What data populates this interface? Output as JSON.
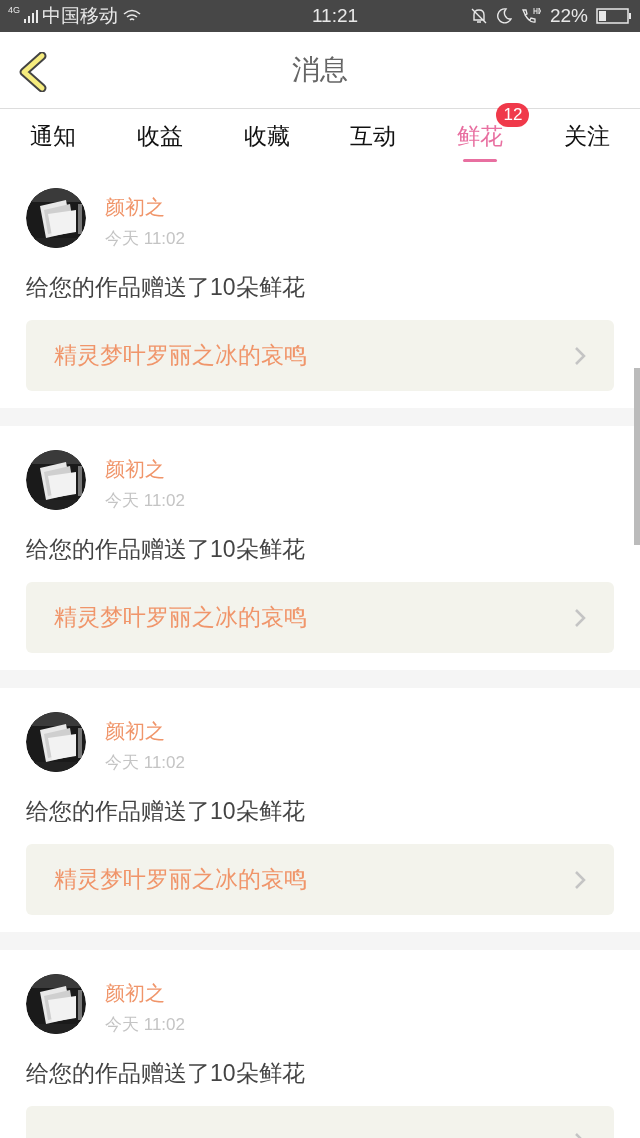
{
  "status_bar": {
    "carrier": "中国移动",
    "time": "11:21",
    "battery": "22%",
    "network": "4G"
  },
  "header": {
    "title": "消息"
  },
  "tabs": [
    {
      "label": "通知",
      "selected": false
    },
    {
      "label": "收益",
      "selected": false
    },
    {
      "label": "收藏",
      "selected": false
    },
    {
      "label": "互动",
      "selected": false
    },
    {
      "label": "鲜花",
      "selected": true,
      "badge": "12"
    },
    {
      "label": "关注",
      "selected": false
    }
  ],
  "messages": [
    {
      "name": "颜初之",
      "time": "今天 11:02",
      "text": "给您的作品赠送了10朵鲜花",
      "work": "精灵梦叶罗丽之冰的哀鸣"
    },
    {
      "name": "颜初之",
      "time": "今天 11:02",
      "text": "给您的作品赠送了10朵鲜花",
      "work": "精灵梦叶罗丽之冰的哀鸣"
    },
    {
      "name": "颜初之",
      "time": "今天 11:02",
      "text": "给您的作品赠送了10朵鲜花",
      "work": "精灵梦叶罗丽之冰的哀鸣"
    },
    {
      "name": "颜初之",
      "time": "今天 11:02",
      "text": "给您的作品赠送了10朵鲜花"
    }
  ]
}
